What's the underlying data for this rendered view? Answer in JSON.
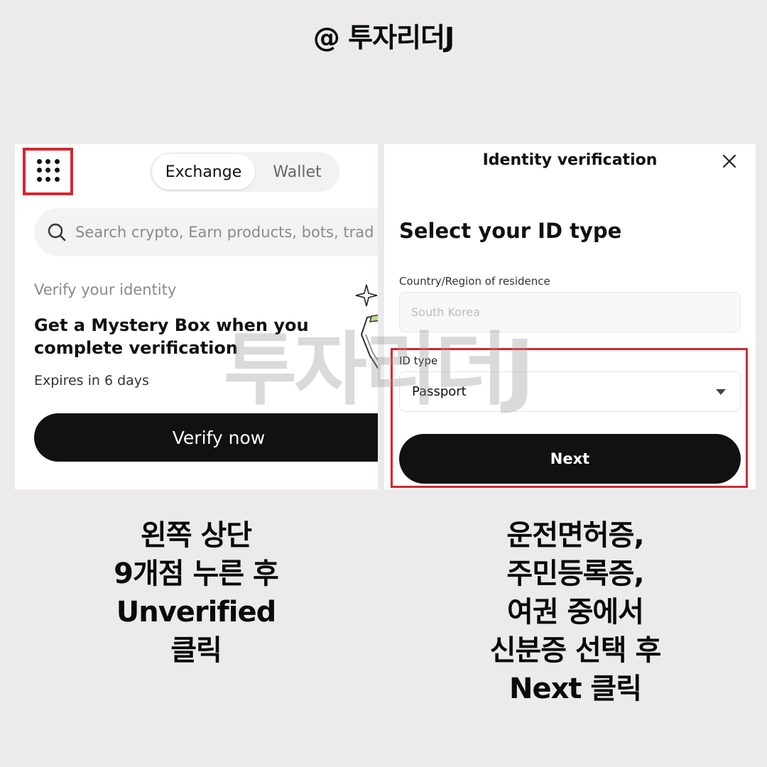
{
  "header": {
    "handle": "@ 투자리더J"
  },
  "watermark": "투자리더J",
  "left_panel": {
    "menu_icon": "grid-9-dots-icon",
    "tabs": [
      {
        "label": "Exchange",
        "active": true
      },
      {
        "label": "Wallet",
        "active": false
      }
    ],
    "search": {
      "placeholder": "Search crypto, Earn products, bots, trad"
    },
    "promo": {
      "label": "Verify your identity",
      "title_line1": "Get a Mystery Box when you",
      "title_line2": "complete verification",
      "expires": "Expires in 6 days",
      "button": "Verify now"
    }
  },
  "right_panel": {
    "title": "Identity verification",
    "heading": "Select your ID type",
    "country": {
      "label": "Country/Region of residence",
      "value": "South Korea"
    },
    "id_type": {
      "label": "ID type",
      "value": "Passport"
    },
    "button": "Next"
  },
  "captions": {
    "left": [
      "왼쪽 상단",
      "9개점 누른 후",
      "Unverified",
      "클릭"
    ],
    "right": [
      "운전면허증,",
      "주민등록증,",
      "여권 중에서",
      "신분증 선택 후",
      "Next 클릭"
    ]
  },
  "colors": {
    "highlight": "#d8262f",
    "button": "#111111",
    "background": "#eceaea"
  }
}
